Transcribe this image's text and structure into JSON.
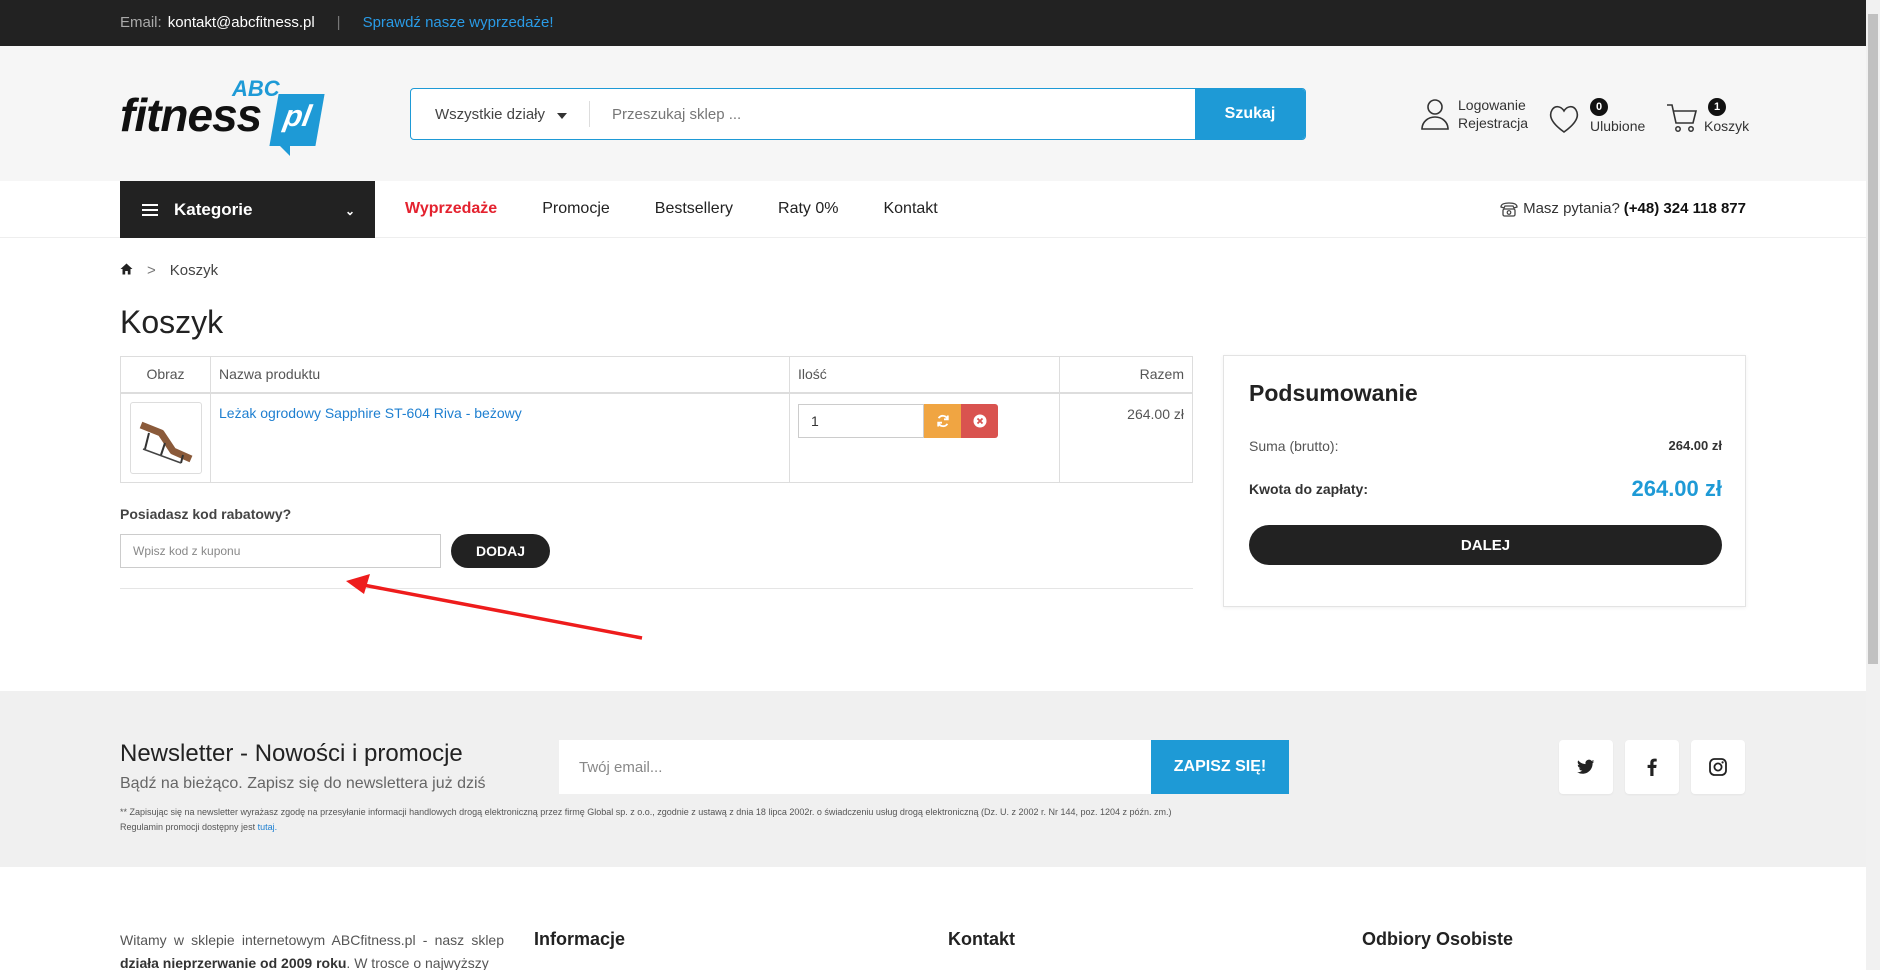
{
  "topbar": {
    "email_label": "Email:",
    "email_value": "kontakt@abcfitness.pl",
    "promo_link": "Sprawdź nasze wyprzedaże!"
  },
  "logo": {
    "abc": "ABC",
    "fitness": "fitness",
    "pl": "pl"
  },
  "search": {
    "category": "Wszystkie działy",
    "placeholder": "Przeszukaj sklep ...",
    "button": "Szukaj"
  },
  "account": {
    "login": "Logowanie",
    "register": "Rejestracja"
  },
  "favorites": {
    "label": "Ulubione",
    "count": "0"
  },
  "cart": {
    "label": "Koszyk",
    "count": "1"
  },
  "nav": {
    "categories": "Kategorie",
    "links": [
      "Wyprzedaże",
      "Promocje",
      "Bestsellery",
      "Raty 0%",
      "Kontakt"
    ],
    "phone_label": "Masz pytania?",
    "phone_number": "(+48) 324 118 877"
  },
  "breadcrumb": {
    "current": "Koszyk"
  },
  "page_title": "Koszyk",
  "cart_table": {
    "headers": [
      "Obraz",
      "Nazwa produktu",
      "Ilość",
      "Razem"
    ],
    "rows": [
      {
        "name": "Leżak ogrodowy Sapphire ST-604 Riva - beżowy",
        "qty": "1",
        "total": "264.00 zł"
      }
    ]
  },
  "coupon": {
    "label": "Posiadasz kod rabatowy?",
    "placeholder": "Wpisz kod z kuponu",
    "button": "DODAJ"
  },
  "summary": {
    "title": "Podsumowanie",
    "sum_label": "Suma (brutto):",
    "sum_value": "264.00 zł",
    "pay_label": "Kwota do zapłaty:",
    "pay_value": "264.00 zł",
    "button": "DALEJ"
  },
  "newsletter": {
    "heading": "Newsletter - Nowości i promocje",
    "subheading": "Bądź na bieżąco. Zapisz się do newslettera już dziś",
    "placeholder": "Twój email...",
    "button": "ZAPISZ SIĘ!",
    "fine_print": "** Zapisując się na newsletter wyrażasz zgodę na przesyłanie informacji handlowych drogą elektroniczną przez firmę Global sp. z o.o., zgodnie z ustawą z dnia 18 lipca 2002r. o świadczeniu usług drogą elektroniczną (Dz. U. z 2002 r. Nr 144, poz. 1204 z późn. zm.)",
    "rules_text": "Regulamin promocji dostępny jest",
    "rules_link": "tutaj."
  },
  "footer": {
    "intro_a": "Witamy w sklepie internetowym ABCfitness.pl - nasz sklep",
    "intro_b": "działa nieprzerwanie od 2009 roku",
    "intro_c": ". W trosce o najwyższy",
    "columns": [
      "Informacje",
      "Kontakt",
      "Odbiory Osobiste"
    ]
  },
  "colors": {
    "accent": "#1e9ad6",
    "sale": "#e4222f",
    "dark": "#222222",
    "update": "#f0a542",
    "delete": "#d9534f",
    "annotation_arrow": "#ee1c1c"
  },
  "icons": [
    "user-icon",
    "heart-icon",
    "cart-icon",
    "phone-icon",
    "home-icon",
    "refresh-icon",
    "remove-icon",
    "twitter-icon",
    "facebook-icon",
    "instagram-icon"
  ]
}
